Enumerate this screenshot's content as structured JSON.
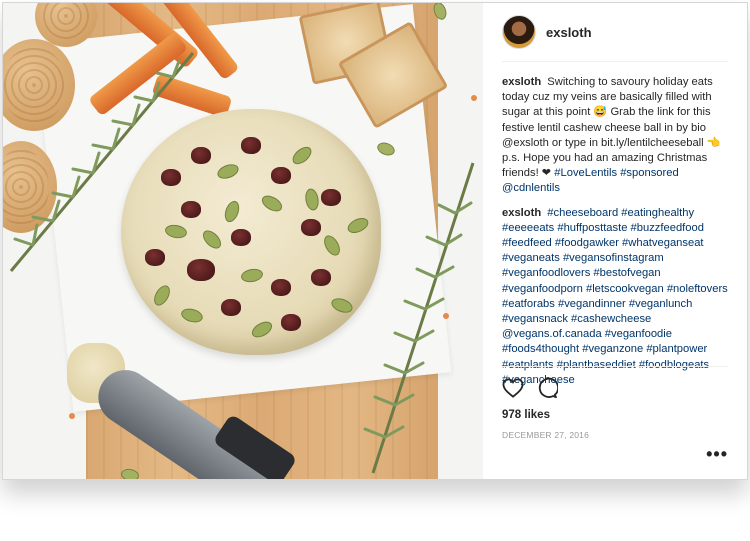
{
  "header": {
    "username": "exsloth"
  },
  "caption": {
    "user": "exsloth",
    "text": "Switching to savoury holiday eats today cuz my veins are basically filled with sugar at this point 😅 Grab the link for this festive lentil cashew cheese ball in by bio @exsloth or type in bit.ly/lentilcheeseball 👈 p.s. Hope you had an amazing Christmas friends! ❤",
    "tags": "#LoveLentils #sponsored @cdnlentils"
  },
  "comment2": {
    "user": "exsloth",
    "tags": "#cheeseboard #eatinghealthy #eeeeeats #huffposttaste #buzzfeedfood #feedfeed #foodgawker #whatveganseat #veganeats #vegansofinstagram #veganfoodlovers #bestofvegan #veganfoodporn #letscookvegan #noleftovers #eatforabs #vegandinner #veganlunch #vegansnack #cashewcheese @vegans.of.canada #veganfoodie #foods4thought #veganzone #plantpower #eatplants #plantbaseddiet #foodblogeats #vegancheese"
  },
  "actions": {
    "like_icon": "heart-icon",
    "comment_icon": "comment-icon",
    "likes": "978 likes",
    "date": "DECEMBER 27, 2016",
    "more_icon": "more-options-icon",
    "more_glyph": "•••"
  },
  "colors": {
    "hashtag": "#003569",
    "text": "#262626",
    "muted": "#999999"
  }
}
